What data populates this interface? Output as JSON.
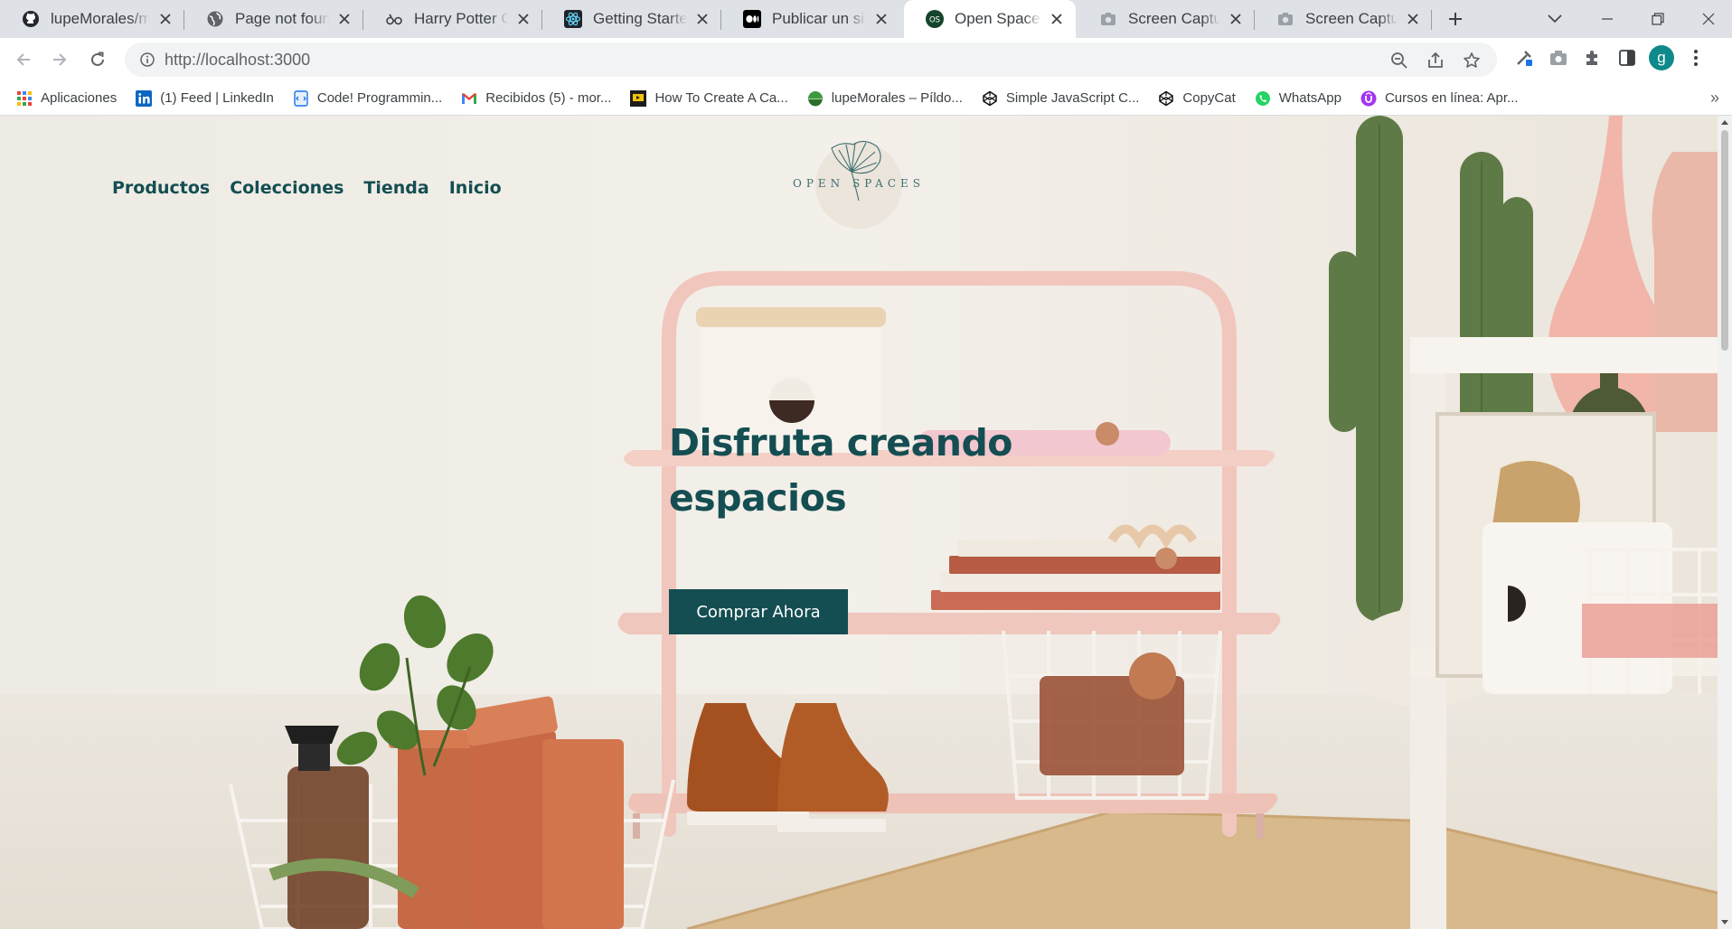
{
  "browser": {
    "tabs": [
      {
        "title": "lupeMorales/mod",
        "icon": "github-icon"
      },
      {
        "title": "Page not found ·",
        "icon": "globe-icon"
      },
      {
        "title": "Harry Potter Char",
        "icon": "glasses-icon"
      },
      {
        "title": "Getting Started –",
        "icon": "react-icon"
      },
      {
        "title": "Publicar un sitio w",
        "icon": "medium-icon"
      },
      {
        "title": "Open Spaces",
        "icon": "os-favicon",
        "favicon_text": "OS"
      },
      {
        "title": "Screen Capture R",
        "icon": "camera-icon"
      },
      {
        "title": "Screen Capture R",
        "icon": "camera-icon"
      }
    ],
    "active_tab": 5,
    "url": "http://localhost:3000",
    "profile_initial": "g",
    "bookmarks": [
      {
        "label": "Aplicaciones",
        "icon": "apps-grid-icon"
      },
      {
        "label": "(1) Feed | LinkedIn",
        "icon": "linkedin-icon"
      },
      {
        "label": "Code! Programmin...",
        "icon": "code-book-icon"
      },
      {
        "label": "Recibidos (5) - mor...",
        "icon": "gmail-icon"
      },
      {
        "label": "How To Create A Ca...",
        "icon": "video-icon"
      },
      {
        "label": "lupeMorales – Píldo...",
        "icon": "leaf-icon"
      },
      {
        "label": "Simple JavaScript C...",
        "icon": "codepen-icon"
      },
      {
        "label": "CopyCat",
        "icon": "codepen-icon"
      },
      {
        "label": "WhatsApp",
        "icon": "whatsapp-icon"
      },
      {
        "label": "Cursos en línea: Apr...",
        "icon": "udemy-icon"
      }
    ],
    "bookmarks_overflow": "»"
  },
  "site": {
    "nav": [
      "Productos",
      "Colecciones",
      "Tienda",
      "Inicio"
    ],
    "logo_text": "OPEN SPACES",
    "headline": "Disfruta creando espacios",
    "cta_label": "Comprar Ahora"
  },
  "colors": {
    "brand": "#144e52",
    "hero_background": "#f2eee8",
    "chrome_tabstrip": "#dee1e6"
  }
}
